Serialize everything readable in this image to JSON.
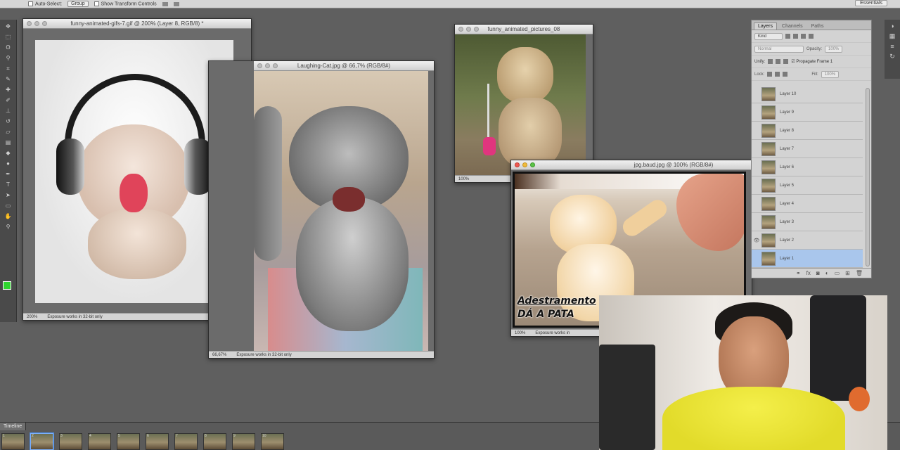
{
  "options_bar": {
    "auto_select_label": "Auto-Select:",
    "auto_select_value": "Group",
    "show_transform_label": "Show Transform Controls",
    "workspace": "Essentials"
  },
  "docs": {
    "kitten": {
      "title": "funny-animated-gifs-7.gif @ 200% (Layer 8, RGB/8) *",
      "zoom": "200%",
      "status": "Exposure works in 32-bit only"
    },
    "cat": {
      "title": "Laughing-Cat.jpg @ 66,7% (RGB/8#)",
      "zoom": "66,67%",
      "status": "Exposure works in 32-bit only"
    },
    "pup": {
      "title": "funny_animated_pictures_08",
      "zoom": "100%"
    },
    "front": {
      "title": "jpg.baud.jpg @ 100% (RGB/8#)",
      "zoom": "100%",
      "status": "Exposure works in",
      "caption_line1": "Adestramento",
      "caption_line2": "DÁ A PATA"
    }
  },
  "layers_panel": {
    "tabs": [
      "Layers",
      "Channels",
      "Paths"
    ],
    "kind_label": "Kind",
    "blend_mode": "Normal",
    "opacity_label": "Opacity:",
    "opacity_value": "100%",
    "unify_label": "Unify:",
    "propagate_label": "Propagate Frame 1",
    "lock_label": "Lock:",
    "fill_label": "Fill:",
    "fill_value": "100%",
    "layers": [
      "Layer 10",
      "Layer 9",
      "Layer 8",
      "Layer 7",
      "Layer 6",
      "Layer 5",
      "Layer 4",
      "Layer 3",
      "Layer 2",
      "Layer 1"
    ],
    "eye_icon": "eye-icon"
  },
  "timeline": {
    "tab_label": "Timeline",
    "frames": [
      "1",
      "2",
      "3",
      "4",
      "5",
      "6",
      "7",
      "8",
      "9",
      "10"
    ]
  }
}
